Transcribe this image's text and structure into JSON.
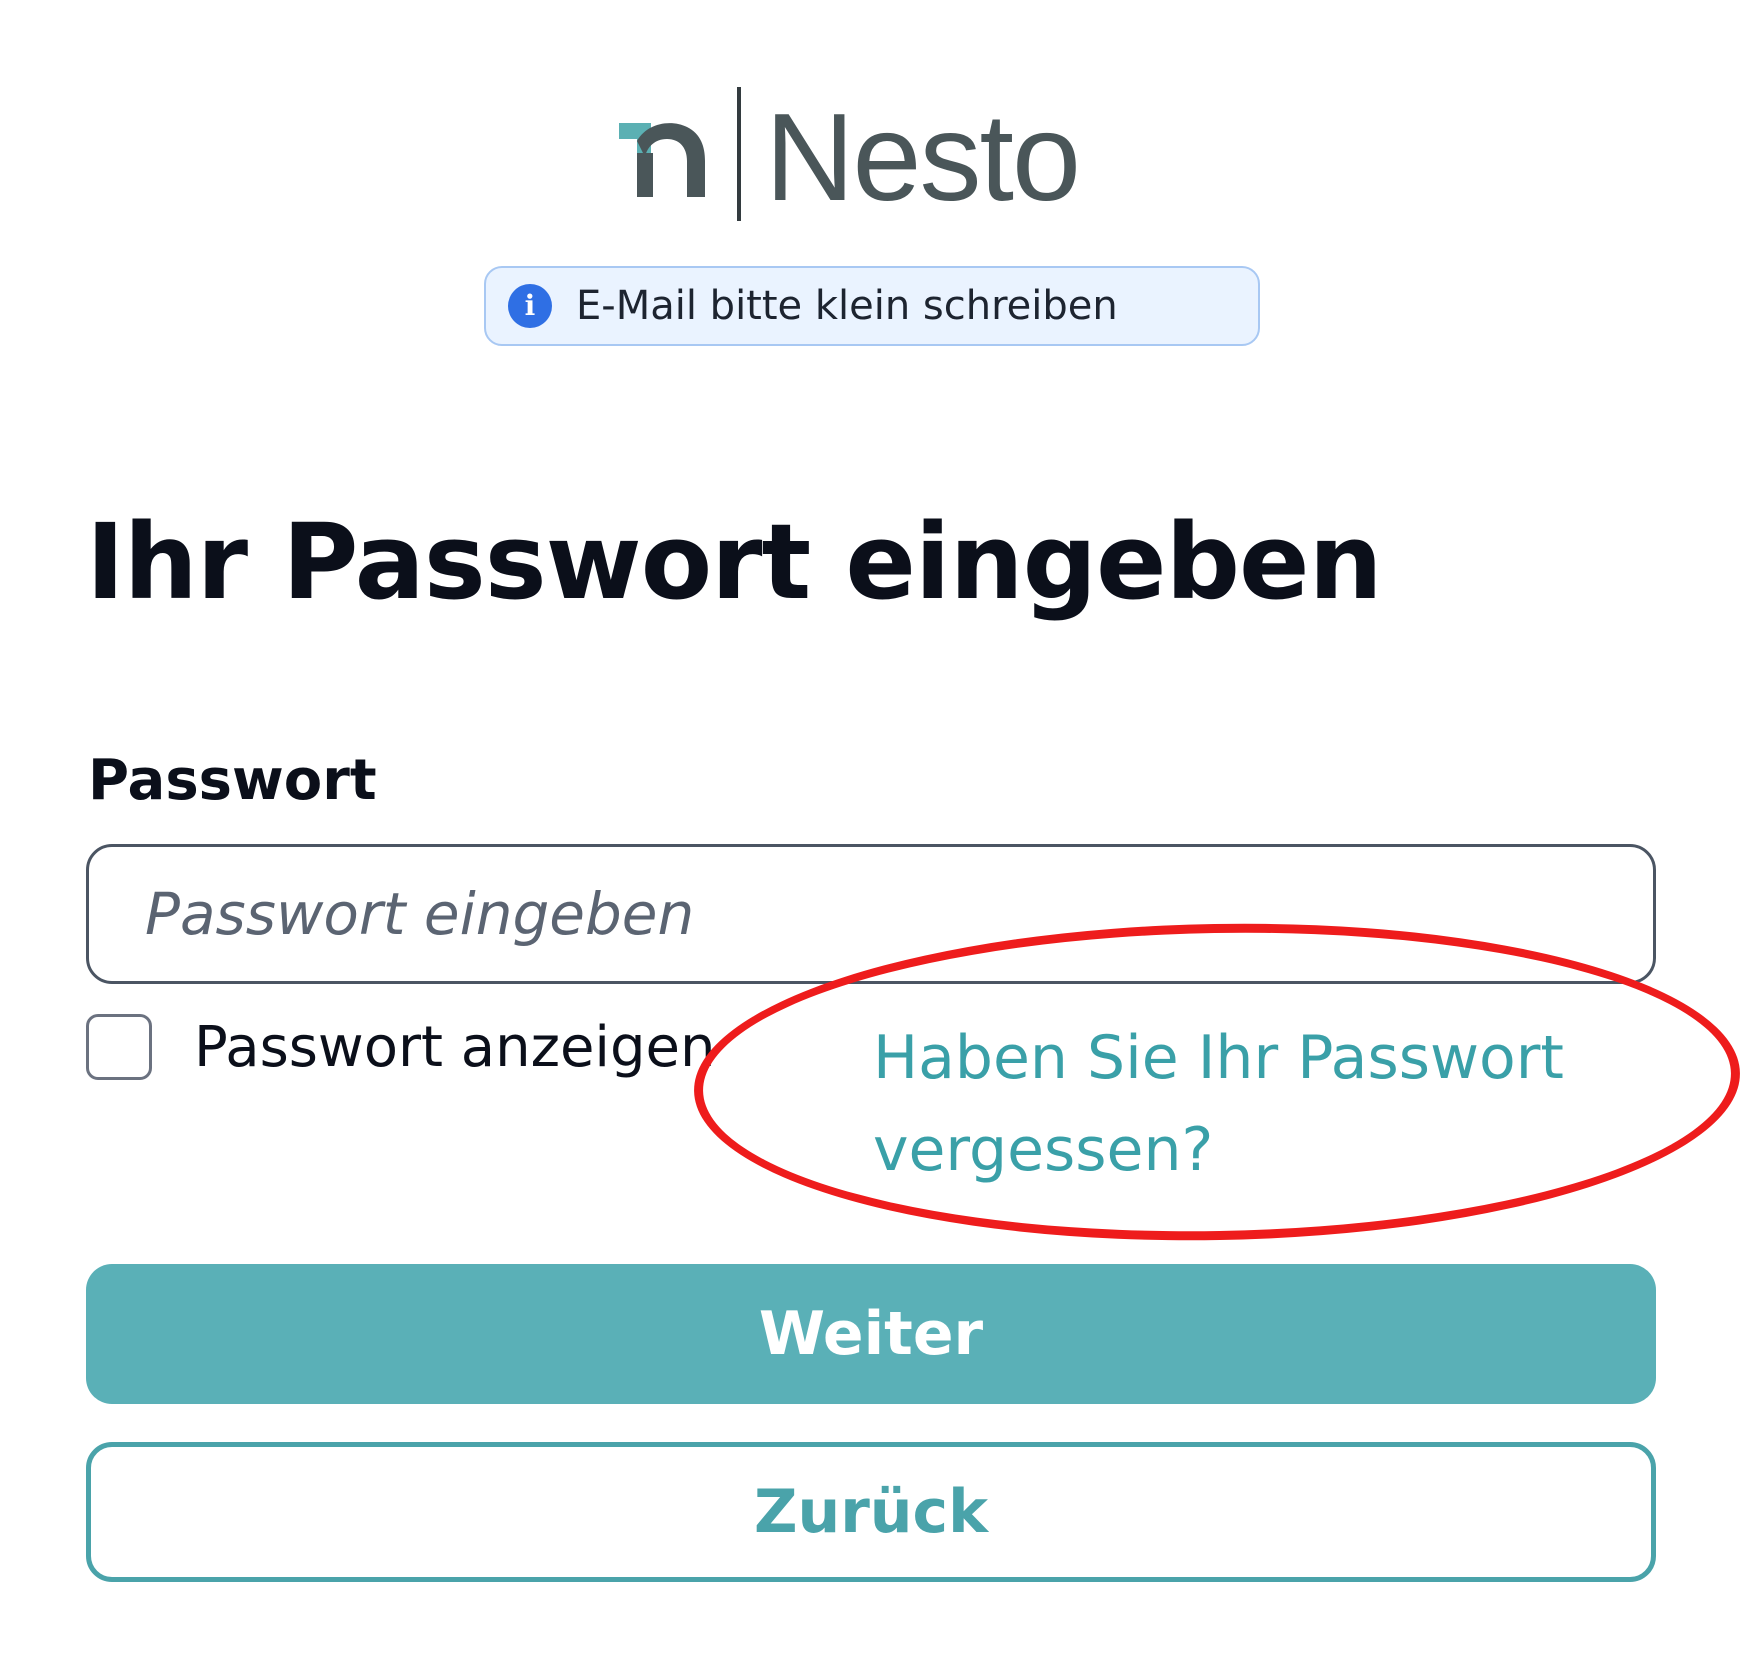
{
  "logo": {
    "wordmark": "Nesto"
  },
  "info_banner": {
    "icon": "info-icon",
    "icon_glyph": "i",
    "text": "E-Mail bitte klein schreiben"
  },
  "page": {
    "title": "Ihr Passwort eingeben"
  },
  "password_field": {
    "label": "Passwort",
    "placeholder": "Passwort eingeben",
    "value": ""
  },
  "show_password": {
    "label": "Passwort anzeigen",
    "checked": false
  },
  "forgot_password": {
    "text": "Haben Sie Ihr Passwort vergessen?"
  },
  "actions": {
    "continue_label": "Weiter",
    "back_label": "Zurück"
  },
  "colors": {
    "accent": "#5ab0b7",
    "link": "#3aa0a8",
    "info_blue": "#2f6fe4",
    "annotation_red": "#ee1c1c"
  }
}
